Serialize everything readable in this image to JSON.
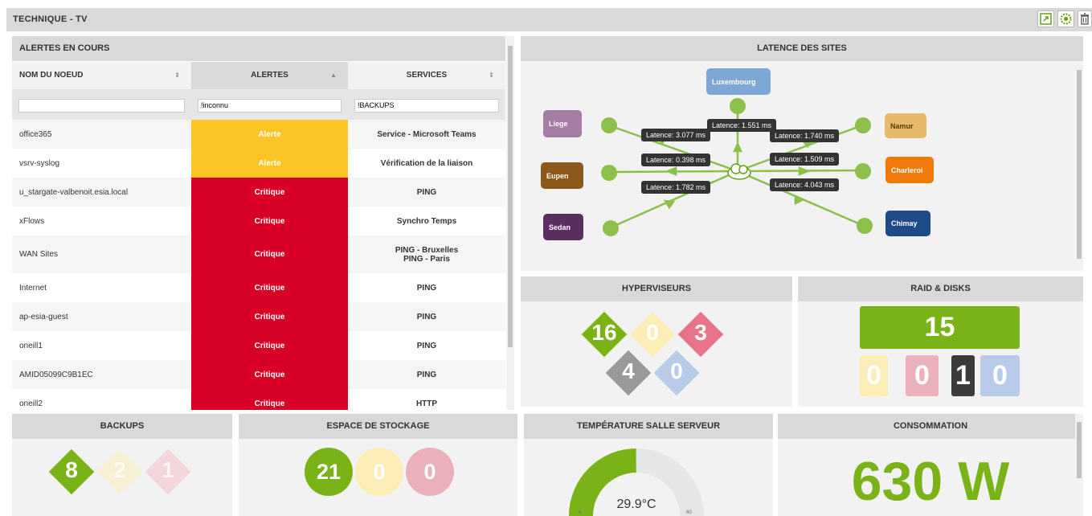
{
  "header": {
    "title": "TECHNIQUE - TV"
  },
  "toolbar": {
    "icons": [
      "expand-icon",
      "gear-icon",
      "trash-icon"
    ]
  },
  "alerts": {
    "title": "ALERTES EN COURS",
    "columns": [
      "NOM DU NOEUD",
      "ALERTES",
      "SERVICES"
    ],
    "filters": {
      "node": "",
      "alert": "!inconnu",
      "service": "!BACKUPS"
    },
    "rows": [
      {
        "node": "office365",
        "alert": "Alerte",
        "severity": "alerte",
        "service": "Service - Microsoft Teams",
        "service2": ""
      },
      {
        "node": "vsrv-syslog",
        "alert": "Alerte",
        "severity": "alerte",
        "service": "Vérification de la liaison",
        "service2": ""
      },
      {
        "node": "u_stargate-valbenoit.esia.local",
        "alert": "Critique",
        "severity": "critique",
        "service": "PING",
        "service2": ""
      },
      {
        "node": "xFlows",
        "alert": "Critique",
        "severity": "critique",
        "service": "Synchro Temps",
        "service2": ""
      },
      {
        "node": "WAN Sites",
        "alert": "Critique",
        "severity": "critique",
        "service": "PING - Bruxelles",
        "service2": "PING - Paris"
      },
      {
        "node": "Internet",
        "alert": "Critique",
        "severity": "critique",
        "service": "PING",
        "service2": ""
      },
      {
        "node": "ap-esia-guest",
        "alert": "Critique",
        "severity": "critique",
        "service": "PING",
        "service2": ""
      },
      {
        "node": "oneill1",
        "alert": "Critique",
        "severity": "critique",
        "service": "PING",
        "service2": ""
      },
      {
        "node": "AMID05099C9B1EC",
        "alert": "Critique",
        "severity": "critique",
        "service": "PING",
        "service2": ""
      },
      {
        "node": "oneill2",
        "alert": "Critique",
        "severity": "critique",
        "service": "HTTP",
        "service2": ""
      }
    ]
  },
  "latency": {
    "title": "LATENCE DES SITES",
    "sites": [
      {
        "name": "Luxembourg",
        "color": "#7fa7d6"
      },
      {
        "name": "Liege",
        "color": "#a57ca3"
      },
      {
        "name": "Eupen",
        "color": "#8b5a1a"
      },
      {
        "name": "Sedan",
        "color": "#5a2e5f"
      },
      {
        "name": "Namur",
        "color": "#e6b96d"
      },
      {
        "name": "Charleroi",
        "color": "#f07a0a"
      },
      {
        "name": "Chimay",
        "color": "#1f4a87"
      }
    ],
    "labels": [
      "Latence: 3.077 ms",
      "Latence: 1.551 ms",
      "Latence: 1.740 ms",
      "Latence: 0.398 ms",
      "Latence: 1.509 ms",
      "Latence: 1.782 ms",
      "Latence: 4.043 ms"
    ]
  },
  "hyperviseurs": {
    "title": "HYPERVISEURS",
    "values": [
      "16",
      "0",
      "3",
      "4",
      "0"
    ]
  },
  "raid": {
    "title": "RAID & DISKS",
    "main": "15",
    "values": [
      "0",
      "0",
      "1",
      "0"
    ]
  },
  "backups": {
    "title": "BACKUPS",
    "values": [
      "8",
      "2",
      "1"
    ]
  },
  "storage": {
    "title": "ESPACE DE STOCKAGE",
    "values": [
      "21",
      "0",
      "0"
    ]
  },
  "temperature": {
    "title": "TEMPÉRATURE SALLE SERVEUR",
    "value": 29.9,
    "display": "29.9°C",
    "min": "0",
    "max": "60"
  },
  "consumption": {
    "title": "CONSOMMATION",
    "value": "630 W"
  },
  "colors": {
    "green": "#7ab317",
    "yellow": "#fdc425",
    "red": "#d80027",
    "grey": "#999999",
    "lightblue": "#b8cbe8",
    "lightyellow": "#fcedb6",
    "pink": "#eab0bb",
    "dark": "#3b3b3b"
  }
}
